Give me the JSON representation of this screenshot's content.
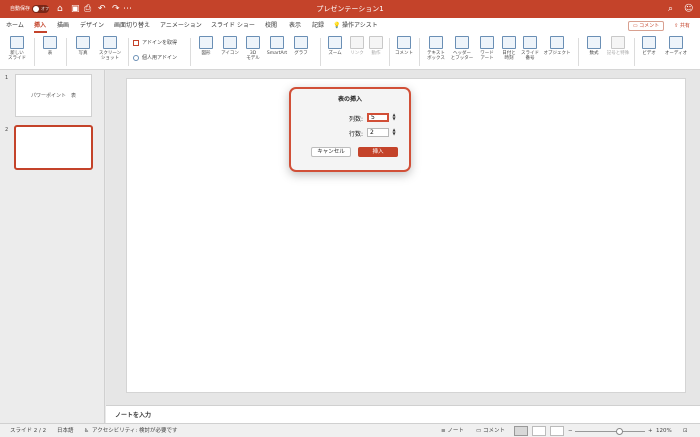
{
  "titlebar": {
    "autosave_label": "自動保存",
    "autosave_state": "オフ",
    "document_title": "プレゼンテーション1",
    "quick_icons": [
      "home-icon",
      "save-icon",
      "print-icon",
      "undo-icon",
      "redo-icon",
      "more-icon"
    ],
    "right_icons": [
      "search-icon",
      "account-icon"
    ]
  },
  "tabs": [
    "ホーム",
    "挿入",
    "描画",
    "デザイン",
    "画面切り替え",
    "アニメーション",
    "スライド ショー",
    "校閲",
    "表示",
    "記録"
  ],
  "active_tab": "挿入",
  "tell_me": "操作アシスト",
  "comment_button": "コメント",
  "share_button": "共有",
  "ribbon": {
    "new_slide": "新しい\nスライド",
    "table": "表",
    "photo": "写真",
    "screenshot": "スクリーン\nショット",
    "get_addins": "アドインを取得",
    "my_addins": "個人用アドイン",
    "shapes": "図形",
    "icons": "アイコン",
    "models3d": "3D\nモデル",
    "smartart": "SmartArt",
    "chart": "グラフ",
    "zoom": "ズーム",
    "link": "リンク",
    "action": "動作",
    "comment": "コメント",
    "textbox": "テキスト\nボックス",
    "header_footer": "ヘッダー\nとフッター",
    "wordart": "ワード\nアート",
    "date_time": "日付と\n時刻",
    "slide_number": "スライド\n番号",
    "object": "オブジェクト",
    "equation": "数式",
    "symbol": "記号と特殊",
    "video": "ビデオ",
    "audio": "オーディオ"
  },
  "slides": [
    {
      "number": "1",
      "text": "パワーポイント　表"
    },
    {
      "number": "2",
      "text": ""
    }
  ],
  "notes_placeholder": "ノートを入力",
  "status": {
    "slide_info": "スライド 2 / 2",
    "language": "日本語",
    "accessibility": "アクセシビリティ: 検討が必要です",
    "notes": "ノート",
    "comments": "コメント",
    "zoom": "120%"
  },
  "dialog": {
    "title": "表の挿入",
    "columns_label": "列数:",
    "columns_value": "5",
    "rows_label": "行数:",
    "rows_value": "2",
    "cancel": "キャンセル",
    "insert": "挿入"
  },
  "colors": {
    "accent": "#c4432a",
    "titlebar": "#c4432a"
  }
}
